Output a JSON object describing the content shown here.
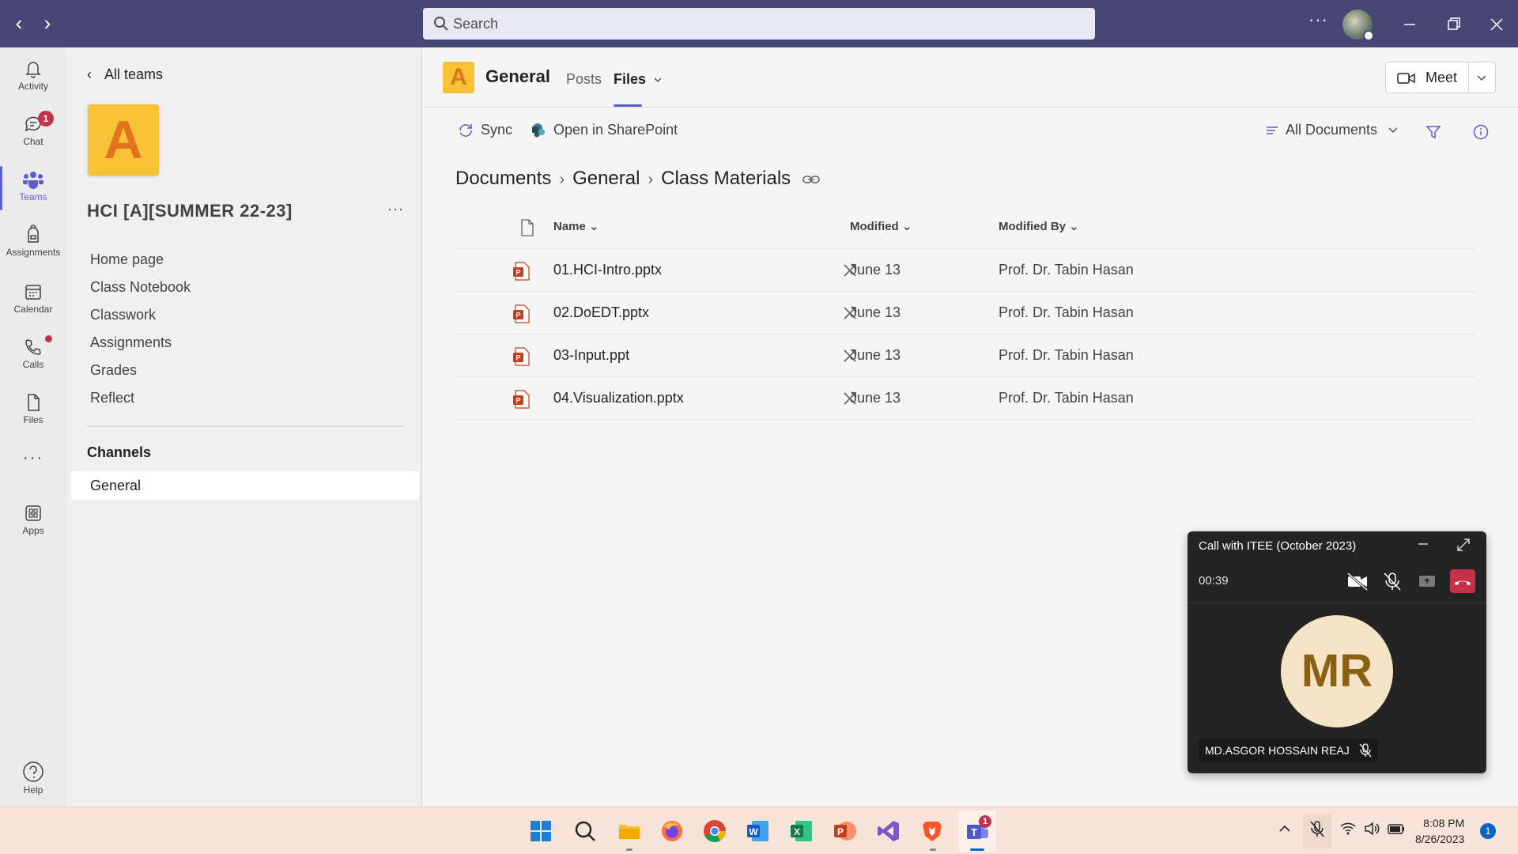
{
  "titlebar": {
    "search_placeholder": "Search",
    "more_icon": "ellipsis-icon"
  },
  "rail": {
    "items": [
      {
        "label": "Activity",
        "icon": "bell-icon"
      },
      {
        "label": "Chat",
        "icon": "chat-icon",
        "badge": "1"
      },
      {
        "label": "Teams",
        "icon": "teams-icon",
        "active": true
      },
      {
        "label": "Assignments",
        "icon": "backpack-icon"
      },
      {
        "label": "Calendar",
        "icon": "calendar-icon"
      },
      {
        "label": "Calls",
        "icon": "phone-icon"
      },
      {
        "label": "Files",
        "icon": "file-icon"
      },
      {
        "label": "Apps",
        "icon": "apps-icon"
      }
    ],
    "help_label": "Help"
  },
  "team_panel": {
    "back_label": "All teams",
    "logo_letter": "A",
    "team_name": "HCI [A][SUMMER 22-23]",
    "links": [
      "Home page",
      "Class Notebook",
      "Classwork",
      "Assignments",
      "Grades",
      "Reflect"
    ],
    "channels_heading": "Channels",
    "channel": "General"
  },
  "channel_header": {
    "logo_letter": "A",
    "title": "General",
    "tabs": [
      "Posts",
      "Files"
    ],
    "active_tab": "Files",
    "meet_label": "Meet"
  },
  "toolbar": {
    "sync": "Sync",
    "open_sharepoint": "Open in SharePoint",
    "view": "All Documents"
  },
  "breadcrumb": [
    "Documents",
    "General",
    "Class Materials"
  ],
  "files": {
    "columns": {
      "name": "Name",
      "modified": "Modified",
      "modified_by": "Modified By"
    },
    "rows": [
      {
        "name": "01.HCI-Intro.pptx",
        "modified": "June 13",
        "modified_by": "Prof. Dr. Tabin Hasan"
      },
      {
        "name": "02.DoEDT.pptx",
        "modified": "June 13",
        "modified_by": "Prof. Dr. Tabin Hasan"
      },
      {
        "name": "03-Input.ppt",
        "modified": "June 13",
        "modified_by": "Prof. Dr. Tabin Hasan"
      },
      {
        "name": "04.Visualization.pptx",
        "modified": "June 13",
        "modified_by": "Prof. Dr. Tabin Hasan"
      }
    ]
  },
  "call": {
    "title": "Call with ITEE (October 2023)",
    "timer": "00:39",
    "initials": "MR",
    "participant": "MD.ASGOR HOSSAIN REAJ"
  },
  "taskbar": {
    "time": "8:08 PM",
    "date": "8/26/2023",
    "notifications": "1",
    "teams_badge": "1"
  },
  "colors": {
    "titlebar": "#464775",
    "accent": "#5b5fc7",
    "team_logo": "#f8c236",
    "hangup": "#c4314b"
  }
}
